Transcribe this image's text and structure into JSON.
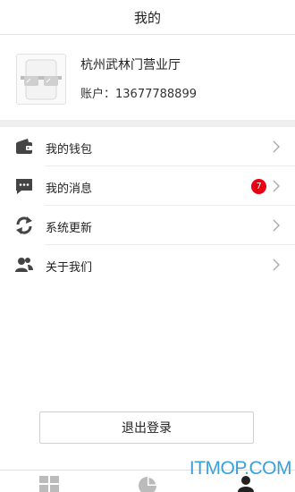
{
  "header": {
    "title": "我的"
  },
  "profile": {
    "shop_name": "杭州武林门营业厅",
    "account_label": "账户：",
    "account_number": "13677788899"
  },
  "menu": {
    "items": [
      {
        "label": "我的钱包",
        "icon": "wallet-icon"
      },
      {
        "label": "我的消息",
        "icon": "message-icon",
        "badge": "7"
      },
      {
        "label": "系统更新",
        "icon": "refresh-icon"
      },
      {
        "label": "关于我们",
        "icon": "people-icon"
      }
    ]
  },
  "logout": {
    "label": "退出登录"
  },
  "tabbar": {
    "tabs": [
      {
        "icon": "grid-icon"
      },
      {
        "icon": "pie-chart-icon"
      },
      {
        "icon": "user-icon"
      }
    ]
  },
  "watermark": {
    "text": "ITMOP.COM"
  },
  "colors": {
    "badge": "#e60012",
    "icon": "#444444",
    "watermark": "#3aa0dc"
  }
}
